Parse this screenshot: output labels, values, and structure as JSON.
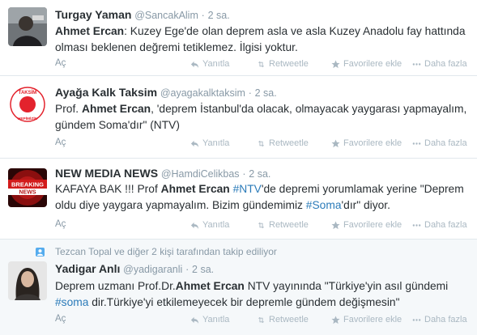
{
  "actions": {
    "open": "Aç",
    "reply": "Yanıtla",
    "retweet": "Retweetle",
    "favorite": "Favorilere ekle",
    "more": "Daha fazla"
  },
  "colors": {
    "link": "#2b7bb9",
    "muted": "#8899a6",
    "text": "#292f33",
    "context_bg": "#f5f8fa"
  },
  "tweets": [
    {
      "name": "Turgay Yaman",
      "handle": "@SancakAlim",
      "sep": "·",
      "time": "2 sa.",
      "avatar": "user-photo",
      "text": [
        {
          "b": "Ahmet Ercan"
        },
        {
          "t": ": Kuzey Ege'de olan deprem asla ve asla Kuzey Anadolu fay hattında olması beklenen değremi tetiklemez. İlgisi yoktur."
        }
      ]
    },
    {
      "name": "Ayağa Kalk Taksim",
      "handle": "@ayagakalktaksim",
      "sep": "·",
      "time": "2 sa.",
      "avatar": "taksim-logo",
      "logo_text_top": "TAKSİM",
      "logo_text_bottom": "HEPİMİZİN",
      "text": [
        {
          "t": "Prof. "
        },
        {
          "b": "Ahmet Ercan"
        },
        {
          "t": ", 'deprem İstanbul'da olacak, olmayacak yaygarası yapmayalım, gündem Soma'dır\" (NTV)"
        }
      ]
    },
    {
      "name": "NEW MEDIA NEWS",
      "handle": "@HamdiCelikbas",
      "sep": "·",
      "time": "2 sa.",
      "avatar": "breaking-news",
      "logo_text_top": "BREAKING",
      "logo_text_bottom": "NEWS",
      "text": [
        {
          "t": "KAFAYA BAK !!! Prof "
        },
        {
          "b": "Ahmet Ercan"
        },
        {
          "t": " "
        },
        {
          "h": "#NTV"
        },
        {
          "t": "'de depremi yorumlamak yerine \"Deprem oldu diye yaygara yapmayalım. Bizim gündemimiz "
        },
        {
          "h": "#Soma"
        },
        {
          "t": "'dır\" diyor."
        }
      ]
    },
    {
      "context": "Tezcan Topal ve diğer 2 kişi tarafından takip ediliyor",
      "name": "Yadigar Anlı",
      "handle": "@yadigaranli",
      "sep": "·",
      "time": "2 sa.",
      "avatar": "user-photo",
      "text": [
        {
          "t": "Deprem uzmanı Prof.Dr."
        },
        {
          "b": "Ahmet Ercan"
        },
        {
          "t": " NTV yayınında \"Türkiye'yin asıl gündemi "
        },
        {
          "h": "#soma"
        },
        {
          "t": " dir.Türkiye'yi etkilemeyecek bir depremle gündem değişmesin\""
        }
      ]
    }
  ]
}
